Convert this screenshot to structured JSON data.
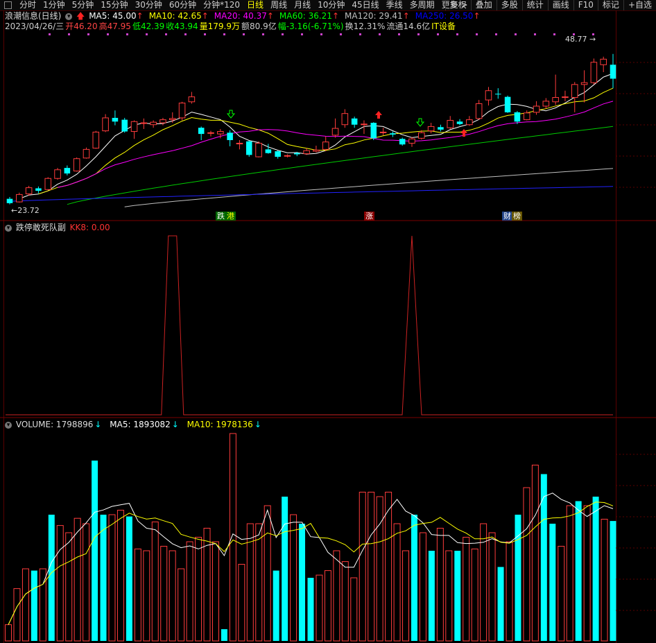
{
  "toolbar": {
    "tabs": [
      "分时",
      "1分钟",
      "5分钟",
      "15分钟",
      "30分钟",
      "60分钟",
      "分钟*120",
      "日线",
      "周线",
      "月线",
      "10分钟",
      "45日线",
      "季线",
      "多周期",
      "更多 >"
    ],
    "active": "日线",
    "right": [
      "复权",
      "叠加",
      "多股",
      "统计",
      "画线",
      "F10",
      "标记",
      "+自选"
    ]
  },
  "stock": {
    "name": "浪潮信息(日线)",
    "ma": [
      {
        "label": "MA5: 45.00",
        "arrow": "↑",
        "color": "#ffffff"
      },
      {
        "label": "MA10: 42.65",
        "arrow": "↑",
        "color": "#ffff00"
      },
      {
        "label": "MA20: 40.37",
        "arrow": "↑",
        "color": "#ff00ff"
      },
      {
        "label": "MA60: 36.21",
        "arrow": "↑",
        "color": "#00ff00"
      },
      {
        "label": "MA120: 29.41",
        "arrow": "↑",
        "color": "#c0c0c0"
      },
      {
        "label": "MA250: 26.50",
        "arrow": "↑",
        "color": "#0000ff"
      }
    ],
    "info": [
      {
        "t": "2023/04/26/三",
        "c": "#cccccc"
      },
      {
        "t": "开46.20",
        "c": "#ff4444"
      },
      {
        "t": "高47.95",
        "c": "#ff4444"
      },
      {
        "t": "低42.39",
        "c": "#00ff00"
      },
      {
        "t": "收43.94",
        "c": "#00ff00"
      },
      {
        "t": "量179.9万",
        "c": "#ffff00"
      },
      {
        "t": "额80.9亿",
        "c": "#cccccc"
      },
      {
        "t": "幅-3.16(-6.71%)",
        "c": "#00ff00"
      },
      {
        "t": "换12.31%",
        "c": "#cccccc"
      },
      {
        "t": "流通14.6亿",
        "c": "#cccccc"
      },
      {
        "t": "IT设备",
        "c": "#ffff00"
      }
    ],
    "high_label": "48.77",
    "low_label": "23.72",
    "markers": [
      {
        "t": "跌",
        "bg": "#006600",
        "fg": "#ffffff"
      },
      {
        "t": "港",
        "bg": "#006600",
        "fg": "#ffff00"
      },
      {
        "t": "涨",
        "bg": "#880000",
        "fg": "#ffffff"
      },
      {
        "t": "财",
        "bg": "#224488",
        "fg": "#ffffff"
      },
      {
        "t": "榜",
        "bg": "#665500",
        "fg": "#ffffff"
      }
    ]
  },
  "indicator": {
    "name": "跌停敢死队副",
    "kk8": "KK8: 0.00",
    "spike_days": [
      17,
      42
    ]
  },
  "volume": {
    "label": "VOLUME: 1798896",
    "arrow": "↓",
    "ma5": "MA5: 1893082",
    "ma10": "MA10: 1978136"
  },
  "chart_data": {
    "type": "candlestick",
    "candles": [
      [
        24.5,
        23.8,
        24.8,
        23.6
      ],
      [
        24.0,
        25.2,
        25.5,
        23.9
      ],
      [
        25.3,
        26.3,
        26.6,
        25.0
      ],
      [
        26.2,
        25.8,
        26.5,
        25.4
      ],
      [
        26.0,
        27.8,
        28.0,
        25.9
      ],
      [
        27.8,
        29.2,
        29.5,
        27.6
      ],
      [
        29.5,
        28.6,
        29.9,
        28.3
      ],
      [
        29.0,
        31.0,
        31.2,
        28.9
      ],
      [
        31.1,
        32.5,
        32.8,
        31.0
      ],
      [
        32.7,
        35.3,
        35.5,
        32.6
      ],
      [
        35.5,
        37.6,
        38.2,
        35.3
      ],
      [
        37.6,
        37.0,
        38.8,
        36.4
      ],
      [
        37.3,
        35.4,
        37.6,
        35.2
      ],
      [
        35.4,
        37.0,
        37.2,
        34.2
      ],
      [
        36.8,
        36.8,
        37.5,
        35.8
      ],
      [
        36.5,
        36.9,
        37.2,
        36.0
      ],
      [
        36.8,
        37.3,
        37.6,
        36.4
      ],
      [
        37.3,
        37.5,
        38.5,
        36.8
      ],
      [
        37.6,
        40.0,
        40.2,
        37.2
      ],
      [
        40.2,
        41.0,
        41.8,
        39.9
      ],
      [
        36.0,
        35.0,
        36.2,
        34.0
      ],
      [
        35.2,
        35.2,
        35.5,
        34.6
      ],
      [
        35.0,
        35.4,
        35.8,
        34.3
      ],
      [
        35.2,
        34.0,
        35.6,
        33.0
      ],
      [
        33.5,
        33.5,
        34.0,
        32.5
      ],
      [
        33.8,
        31.6,
        33.9,
        31.3
      ],
      [
        31.3,
        33.5,
        33.8,
        31.2
      ],
      [
        32.5,
        31.9,
        33.4,
        31.8
      ],
      [
        32.2,
        31.3,
        32.3,
        31.0
      ],
      [
        31.5,
        31.5,
        31.7,
        31.2
      ],
      [
        31.9,
        31.7,
        32.1,
        31.4
      ],
      [
        31.8,
        32.3,
        32.7,
        31.6
      ],
      [
        32.2,
        32.4,
        33.1,
        32.0
      ],
      [
        32.5,
        33.7,
        34.6,
        32.2
      ],
      [
        34.8,
        35.9,
        37.5,
        34.4
      ],
      [
        36.5,
        38.3,
        39.0,
        36.0
      ],
      [
        37.5,
        36.5,
        37.8,
        36.0
      ],
      [
        36.6,
        36.6,
        37.2,
        35.0
      ],
      [
        36.8,
        34.3,
        36.9,
        34.0
      ],
      [
        35.3,
        35.3,
        36.0,
        34.8
      ],
      [
        35.1,
        34.9,
        35.4,
        34.5
      ],
      [
        34.2,
        33.3,
        34.4,
        33.1
      ],
      [
        33.5,
        34.2,
        34.5,
        32.9
      ],
      [
        34.3,
        35.2,
        35.6,
        34.1
      ],
      [
        35.5,
        36.2,
        36.8,
        35.1
      ],
      [
        36.1,
        35.7,
        36.5,
        35.4
      ],
      [
        36.0,
        37.2,
        37.9,
        35.8
      ],
      [
        37.0,
        36.6,
        37.4,
        36.4
      ],
      [
        36.5,
        37.3,
        37.9,
        36.3
      ],
      [
        37.5,
        39.9,
        40.5,
        37.3
      ],
      [
        40.5,
        42.0,
        42.6,
        39.6
      ],
      [
        41.5,
        41.4,
        42.4,
        40.7
      ],
      [
        41.0,
        38.5,
        41.2,
        38.4
      ],
      [
        38.5,
        37.0,
        38.7,
        36.6
      ],
      [
        37.3,
        38.4,
        38.8,
        37.2
      ],
      [
        38.5,
        39.5,
        40.3,
        38.1
      ],
      [
        39.5,
        40.3,
        40.8,
        39.1
      ],
      [
        40.2,
        40.9,
        44.6,
        39.7
      ],
      [
        40.9,
        41.0,
        42.0,
        40.3
      ],
      [
        40.9,
        43.0,
        43.4,
        38.5
      ],
      [
        43.0,
        43.3,
        45.3,
        40.1
      ],
      [
        43.3,
        46.6,
        47.2,
        43.0
      ],
      [
        46.2,
        47.1,
        47.5,
        45.0
      ],
      [
        46.2,
        43.94,
        47.95,
        42.39
      ]
    ],
    "ma5_end": 45.0,
    "ma10_end": 42.65,
    "ma20_end": 40.37,
    "ma60_end": 36.21,
    "ma120_end": 29.41,
    "ma250_end": 26.5,
    "y_range": [
      23.0,
      50.5
    ],
    "volume": [
      [
        180,
        "up"
      ],
      [
        580,
        "up"
      ],
      [
        800,
        "up"
      ],
      [
        780,
        "down"
      ],
      [
        800,
        "up"
      ],
      [
        1400,
        "down"
      ],
      [
        1280,
        "up"
      ],
      [
        1200,
        "up"
      ],
      [
        1360,
        "up"
      ],
      [
        1300,
        "up"
      ],
      [
        2000,
        "down"
      ],
      [
        1400,
        "down"
      ],
      [
        1400,
        "up"
      ],
      [
        1450,
        "up"
      ],
      [
        1380,
        "down"
      ],
      [
        1020,
        "up"
      ],
      [
        1000,
        "up"
      ],
      [
        1320,
        "up"
      ],
      [
        1050,
        "up"
      ],
      [
        1000,
        "up"
      ],
      [
        800,
        "up"
      ],
      [
        1100,
        "up"
      ],
      [
        1150,
        "up"
      ],
      [
        1250,
        "up"
      ],
      [
        1100,
        "up"
      ],
      [
        130,
        "down"
      ],
      [
        2300,
        "up"
      ],
      [
        850,
        "up"
      ],
      [
        1300,
        "up"
      ],
      [
        1300,
        "up"
      ],
      [
        1500,
        "up"
      ],
      [
        780,
        "down"
      ],
      [
        1600,
        "down"
      ],
      [
        1400,
        "up"
      ],
      [
        1300,
        "down"
      ],
      [
        700,
        "down"
      ],
      [
        730,
        "up"
      ],
      [
        780,
        "up"
      ],
      [
        1000,
        "up"
      ],
      [
        880,
        "up"
      ],
      [
        700,
        "up"
      ],
      [
        1650,
        "up"
      ],
      [
        1650,
        "up"
      ],
      [
        1600,
        "up"
      ],
      [
        1650,
        "up"
      ],
      [
        1300,
        "up"
      ],
      [
        1000,
        "up"
      ],
      [
        1400,
        "down"
      ],
      [
        1200,
        "up"
      ],
      [
        1000,
        "down"
      ],
      [
        1250,
        "up"
      ],
      [
        1000,
        "up"
      ],
      [
        1000,
        "down"
      ],
      [
        1150,
        "up"
      ],
      [
        1020,
        "up"
      ],
      [
        1300,
        "up"
      ],
      [
        1200,
        "up"
      ],
      [
        820,
        "down"
      ],
      [
        1100,
        "up"
      ],
      [
        1400,
        "down"
      ],
      [
        1700,
        "up"
      ],
      [
        1950,
        "up"
      ],
      [
        1850,
        "down"
      ],
      [
        1300,
        "down"
      ],
      [
        1050,
        "up"
      ],
      [
        1500,
        "up"
      ],
      [
        1550,
        "down"
      ],
      [
        1500,
        "up"
      ],
      [
        1600,
        "down"
      ],
      [
        1350,
        "up"
      ],
      [
        1330,
        "down"
      ]
    ],
    "volume_max": 2300
  }
}
